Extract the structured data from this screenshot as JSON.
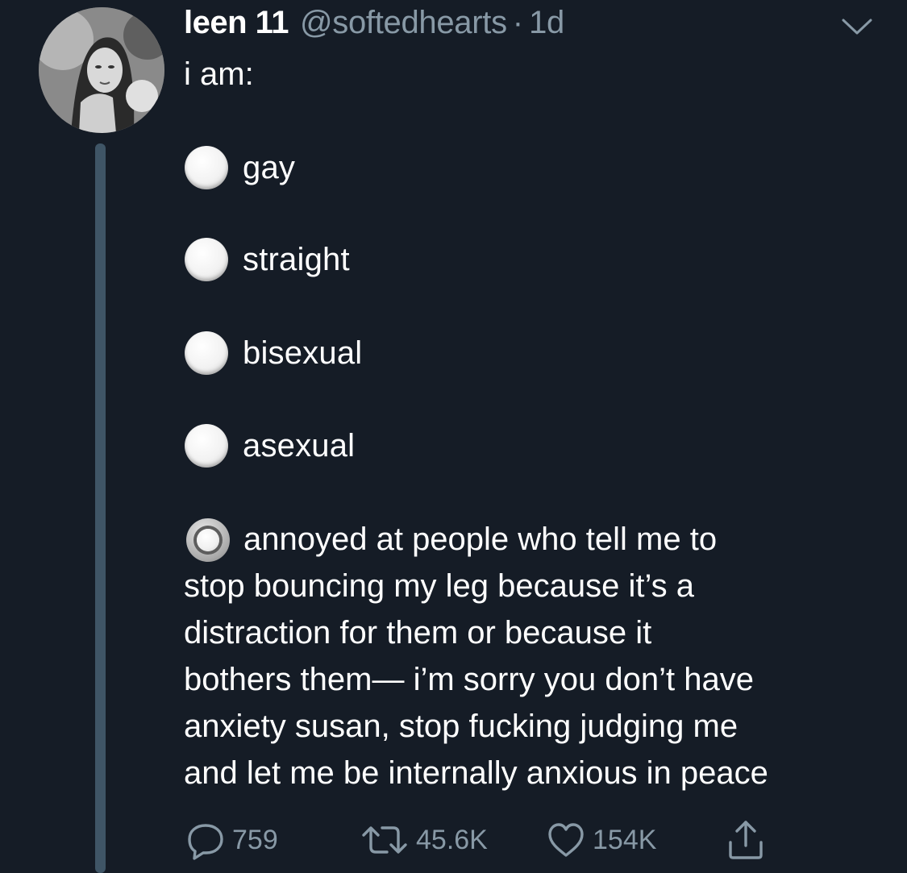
{
  "tweet": {
    "display_name": "leen 11",
    "handle": "@softedhearts",
    "separator": "·",
    "timestamp": "1d",
    "intro": "i am:",
    "options": [
      {
        "label": "gay",
        "selected": false
      },
      {
        "label": "straight",
        "selected": false
      },
      {
        "label": "bisexual",
        "selected": false
      },
      {
        "label": "asexual",
        "selected": false
      }
    ],
    "selected_option": {
      "first_line": "annoyed at people who tell me to",
      "lines": [
        "stop bouncing my leg because it’s a",
        "distraction for them or because it",
        "bothers them— i’m sorry you don’t have",
        "anxiety susan, stop fucking judging me",
        "and let me be internally anxious in peace"
      ]
    },
    "actions": {
      "replies": "759",
      "retweets": "45.6K",
      "likes": "154K"
    }
  },
  "icons": {
    "menu": "chevron-down-icon",
    "reply": "reply-icon",
    "retweet": "retweet-icon",
    "like": "heart-icon",
    "share": "share-icon"
  },
  "colors": {
    "background": "#151c26",
    "text_primary": "#ffffff",
    "text_secondary": "#8899a6",
    "thread_line": "#3f5566"
  }
}
